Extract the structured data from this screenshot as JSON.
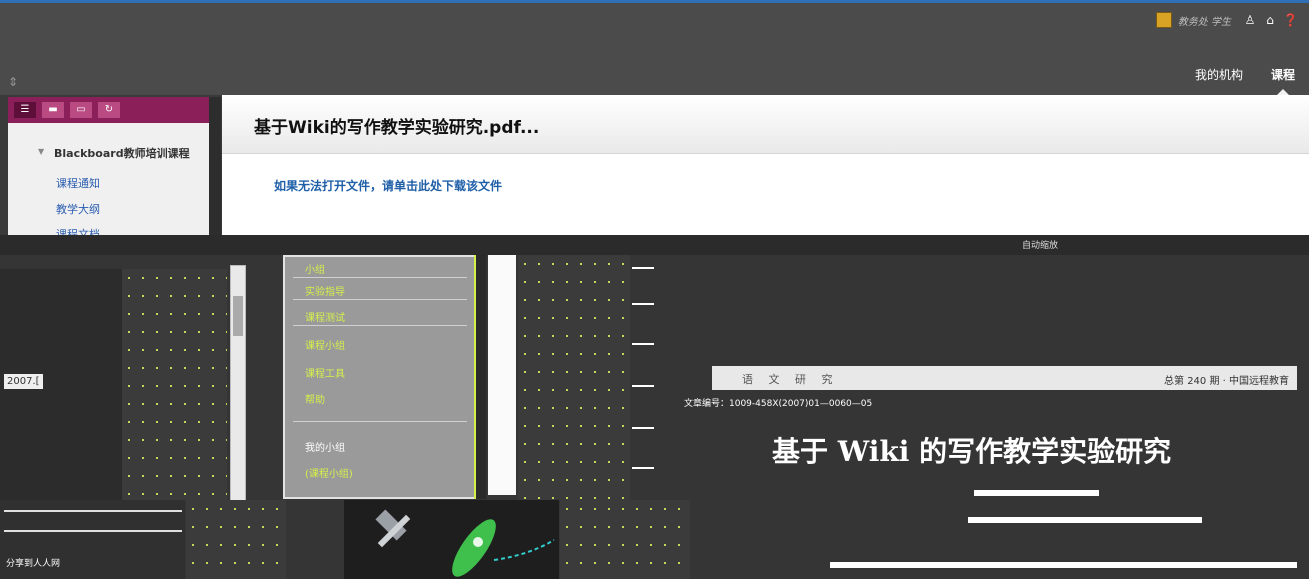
{
  "header": {
    "user_name": "教务处 学生",
    "nav_tabs": [
      {
        "label": "我的机构",
        "active": false
      },
      {
        "label": "课程",
        "active": true
      }
    ],
    "accent_color": "#2e6fb5"
  },
  "sidebar": {
    "course_name": "Blackboard教师培训课程",
    "items": [
      {
        "label": "课程通知"
      },
      {
        "label": "教学大纲"
      },
      {
        "label": "课程文档"
      }
    ],
    "theme_color": "#8a1f5a"
  },
  "content": {
    "document_title": "基于Wiki的写作教学实验研究.pdf...",
    "download_link": "如果无法打开文件，请单击此处下载该文件"
  },
  "viewer": {
    "toolbar_auto_label": "自动缩放",
    "menu_items": [
      {
        "label": "小组"
      },
      {
        "label": "实验指导"
      },
      {
        "label": "课程测试"
      },
      {
        "label": "课程小组"
      },
      {
        "label": "课程工具"
      },
      {
        "label": "帮助"
      },
      {
        "label": "我的小组"
      },
      {
        "label": "(课程小组)"
      }
    ],
    "left_date": "2007.[",
    "bottom_left_label": "分享到人人网",
    "page": {
      "header_left": "语 文 研 究",
      "header_right": "总第 240 期 · 中国远程教育",
      "doc_number": "文章编号：1009-458X(2007)01—0060—05",
      "paper_title": "基于 Wiki 的写作教学实验研究"
    }
  }
}
